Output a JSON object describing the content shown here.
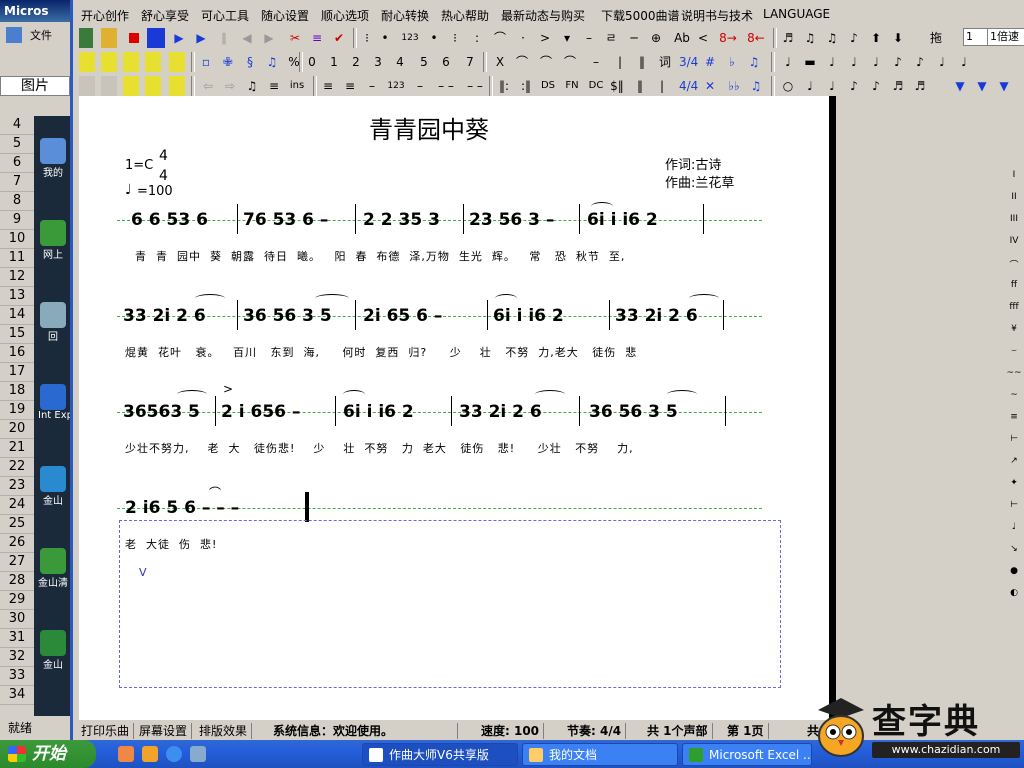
{
  "excel": {
    "title": "Micros",
    "menu_label": "文件",
    "namebox": "图片",
    "rows": [
      "4",
      "5",
      "6",
      "7",
      "8",
      "9",
      "10",
      "11",
      "12",
      "13",
      "14",
      "15",
      "16",
      "17",
      "18",
      "19",
      "20",
      "21",
      "22",
      "23",
      "24",
      "25",
      "26",
      "27",
      "28",
      "29",
      "30",
      "31",
      "32",
      "33",
      "34"
    ],
    "desktop_icons": [
      "我的",
      "网上",
      "回",
      "Int\nExp",
      "金山",
      "金山清",
      "金山"
    ],
    "status": "就绪"
  },
  "app": {
    "menu": [
      "开心创作",
      "舒心享受",
      "可心工具",
      "随心设置",
      "顺心选项",
      "耐心转换",
      "热心帮助",
      "最新动态与购买",
      "下载5000曲谱",
      "说明书与技术",
      "LANGUAGE"
    ],
    "toolbar1": {
      "digits": "123",
      "text_ab": "Ab",
      "eight_up": "8→",
      "eight_down": "8←",
      "drag_label": "拖",
      "zoom": "1",
      "speed": "1倍速"
    },
    "toolbar2": {
      "digits": [
        "0",
        "1",
        "2",
        "3",
        "4",
        "5",
        "6",
        "7"
      ],
      "x": "X",
      "ci": "词",
      "time_sig": "3/4",
      "sharp": "#",
      "flat": "♭"
    },
    "toolbar3": {
      "ins": "ins",
      "digits": "123",
      "ds": "DS",
      "fn": "FN",
      "dc": "DC",
      "time_sig": "4/4",
      "cross": "✕",
      "dflat": "♭♭"
    }
  },
  "score": {
    "title": "青青园中葵",
    "key": "1=C",
    "time_top": "4",
    "time_bottom": "4",
    "tempo": "=100",
    "lyricist": "作词:古诗",
    "composer": "作曲:兰花草",
    "line1_notes": [
      "6 6 53 6",
      "76 53 6 –",
      "2 2 35 3",
      "23 56 3 –",
      "6i i i6 2"
    ],
    "line1_lyrics": "青  青  园中  葵  朝露  待日  曦。   阳  春  布德  泽,万物  生光  辉。   常   恐  秋节  至,",
    "line2_notes": [
      "33 2i 2 6",
      "36 56 3 5",
      "2i 65 6 –",
      "6i i i6 2",
      "33 2i 2 6"
    ],
    "line2_lyrics": "焜黄  花叶   衰。   百川   东到  海,     何时  复西  归?     少    壮   不努  力,老大   徒伤  悲",
    "line3_notes": [
      "36563 5",
      "2 i 656 –",
      "6i i i6 2",
      "33 2i 2 6",
      "36 56 3 5"
    ],
    "line3_lyrics": "少壮不努力,    老  大   徒伤悲!    少    壮  不努   力  老大   徒伤   悲!     少壮   不努    力,",
    "line4_notes": "2 i6 5 6 – – –",
    "line4_lyrics": "老  大徒  伤  悲!",
    "cursor": "V"
  },
  "right_tools": [
    "I",
    "II",
    "III",
    "IV",
    "⌒",
    "ff",
    "fff",
    "¥",
    "⌣",
    "~~",
    "~",
    "≡",
    "⊢",
    "↗",
    "✦",
    "⊢",
    "♩",
    "↘",
    "●",
    "◐"
  ],
  "status": {
    "print": "打印乐曲",
    "screen": "屏幕设置",
    "layout": "排版效果",
    "info": "系统信息：欢迎使用。",
    "speed": "速度: 100",
    "beat": "节奏: 4/4",
    "sections": "共 1个声部",
    "page": "第 1页",
    "extra": "共"
  },
  "taskbar": {
    "start": "开始",
    "tasks": [
      "作曲大师V6共享版",
      "我的文档",
      "Microsoft Excel ..."
    ]
  },
  "watermark": {
    "text": "查字典",
    "url": "www.chazidian.com"
  }
}
